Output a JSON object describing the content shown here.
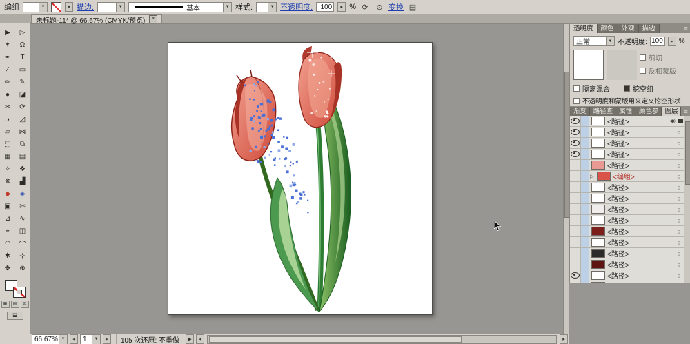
{
  "icons": {
    "chevron_down": "▼",
    "spinner_right": "▸",
    "left_arrow": "◂",
    "right_arrow": "▸",
    "play": "▶",
    "close": "×",
    "menu": "≣",
    "target_circle": "○",
    "target_selected": "◉",
    "group_triangle": "▷",
    "recolor_icon": "⟳",
    "align_icon": "⊙",
    "doc_setup_icon": "▤",
    "color_btn": "▦",
    "gradient_btn": "▤",
    "none_btn": "⊘",
    "mode_btn": "⬓"
  },
  "control_bar": {
    "context_label": "编组",
    "stroke_link": "描边:",
    "brush_value": "基本",
    "style_label": "样式:",
    "opacity_link": "不透明度:",
    "opacity_value": "100",
    "percent_sign": "%",
    "transform_link": "变换"
  },
  "document_tab": {
    "title": "未标题-11* @ 66.67% (CMYK/预览)"
  },
  "toolbar": {
    "tools": [
      {
        "name": "selection-tool",
        "glyph": "▶"
      },
      {
        "name": "direct-selection-tool",
        "glyph": "▷"
      },
      {
        "name": "magic-wand-tool",
        "glyph": "✶"
      },
      {
        "name": "lasso-tool",
        "glyph": "Ω"
      },
      {
        "name": "pen-tool",
        "glyph": "✒"
      },
      {
        "name": "type-tool",
        "glyph": "T"
      },
      {
        "name": "line-segment-tool",
        "glyph": "∕"
      },
      {
        "name": "rectangle-tool",
        "glyph": "▭"
      },
      {
        "name": "paintbrush-tool",
        "glyph": "✏"
      },
      {
        "name": "pencil-tool",
        "glyph": "✎"
      },
      {
        "name": "blob-brush-tool",
        "glyph": "●"
      },
      {
        "name": "eraser-tool",
        "glyph": "◪"
      },
      {
        "name": "scissors-tool",
        "glyph": "✂"
      },
      {
        "name": "rotate-tool",
        "glyph": "⟳"
      },
      {
        "name": "reflect-tool",
        "glyph": "◑"
      },
      {
        "name": "scale-tool",
        "glyph": "◿"
      },
      {
        "name": "shear-tool",
        "glyph": "▱"
      },
      {
        "name": "width-tool",
        "glyph": "⋈"
      },
      {
        "name": "free-transform-tool",
        "glyph": "⬚"
      },
      {
        "name": "shape-builder-tool",
        "glyph": "⧉"
      },
      {
        "name": "mesh-tool",
        "glyph": "▦"
      },
      {
        "name": "gradient-tool",
        "glyph": "▤"
      },
      {
        "name": "eyedropper-tool",
        "glyph": "✧"
      },
      {
        "name": "blend-tool",
        "glyph": "❖"
      },
      {
        "name": "symbol-sprayer-tool",
        "glyph": "❋"
      },
      {
        "name": "column-graph-tool",
        "glyph": "▟"
      },
      {
        "name": "live-paint-bucket-tool",
        "glyph": "◆",
        "color": "#c0392b"
      },
      {
        "name": "live-paint-selection-tool",
        "glyph": "◈",
        "color": "#2d4fae"
      },
      {
        "name": "artboard-tool",
        "glyph": "▣"
      },
      {
        "name": "slice-tool",
        "glyph": "✄"
      },
      {
        "name": "perspective-grid-tool",
        "glyph": "⊿"
      },
      {
        "name": "curvature-tool",
        "glyph": "∿"
      },
      {
        "name": "measure-tool",
        "glyph": "⌖"
      },
      {
        "name": "print-tiling-tool",
        "glyph": "◫"
      },
      {
        "name": "rotate-view-tool",
        "glyph": "◠"
      },
      {
        "name": "join-tool",
        "glyph": "⌒"
      },
      {
        "name": "shaper-tool",
        "glyph": "✱"
      },
      {
        "name": "puppet-warp-tool",
        "glyph": "⊹"
      },
      {
        "name": "hand-tool",
        "glyph": "✥"
      },
      {
        "name": "zoom-tool",
        "glyph": "⊕"
      }
    ]
  },
  "transparency_panel": {
    "tabs": [
      "透明度",
      "颜色",
      "外观",
      "描边"
    ],
    "active_tab": "透明度",
    "blend_mode": "正常",
    "opacity_label": "不透明度:",
    "opacity_value": "100",
    "percent_sign": "%",
    "clip_label": "剪切",
    "invert_mask_label": "反相蒙版",
    "isolate_label": "隔离混合",
    "knockout_label": "挖空组",
    "knockout_shape_label": "不透明度和蒙版用来定义挖空形状"
  },
  "layers_panel": {
    "tabs": [
      "渐变",
      "路径查",
      "属性",
      "颜色参",
      "图层"
    ],
    "active_tab": "图层",
    "rows": [
      {
        "label": "<路径>",
        "eye": true,
        "thumb": "#ffffff",
        "selected": true
      },
      {
        "label": "<路径>",
        "eye": true,
        "thumb": "#ffffff"
      },
      {
        "label": "<路径>",
        "eye": true,
        "thumb": "#ffffff"
      },
      {
        "label": "<路径>",
        "eye": true,
        "thumb": "#ffffff"
      },
      {
        "label": "<路径>",
        "eye": false,
        "thumb": "#e89a92"
      },
      {
        "label": "<编组>",
        "eye": false,
        "thumb": "#d95348",
        "group": true
      },
      {
        "label": "<路径>",
        "eye": false,
        "thumb": "#ffffff"
      },
      {
        "label": "<路径>",
        "eye": false,
        "thumb": "#ffffff"
      },
      {
        "label": "<路径>",
        "eye": false,
        "thumb": "#efeeec"
      },
      {
        "label": "<路径>",
        "eye": false,
        "thumb": "#ffffff"
      },
      {
        "label": "<路径>",
        "eye": false,
        "thumb": "#7c1f1a"
      },
      {
        "label": "<路径>",
        "eye": false,
        "thumb": "#ffffff"
      },
      {
        "label": "<路径>",
        "eye": false,
        "thumb": "#2b2b2b"
      },
      {
        "label": "<路径>",
        "eye": false,
        "thumb": "#5e1512"
      },
      {
        "label": "<路径>",
        "eye": true,
        "thumb": "#ffffff"
      },
      {
        "label": "<路径>",
        "eye": false,
        "thumb": "circles"
      }
    ]
  },
  "status_bar": {
    "zoom": "66.67%",
    "artboard_number": "1",
    "history": "105 次还原: 不重做"
  },
  "artwork": {
    "scatter_color": "#4a6fd4",
    "scatter_color_light": "#8fa8e8",
    "scatter_count": 95,
    "sparkle_count": 20
  }
}
